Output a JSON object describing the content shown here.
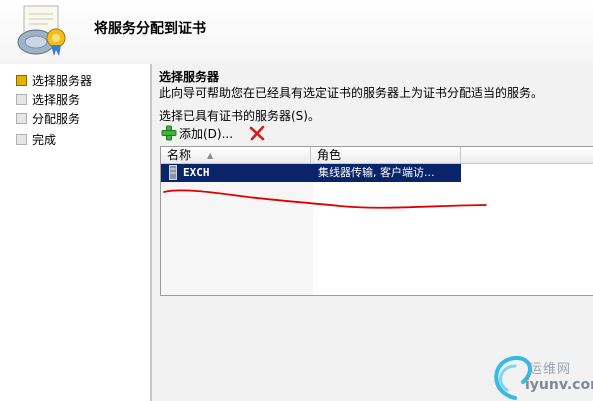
{
  "wizard": {
    "title": "将服务分配到证书",
    "icon": "certificate-server-icon"
  },
  "steps": [
    {
      "label": "选择服务器",
      "active": true
    },
    {
      "label": "选择服务",
      "active": false
    },
    {
      "label": "分配服务",
      "active": false
    },
    {
      "label": "完成",
      "active": false
    }
  ],
  "page": {
    "section_title": "选择服务器",
    "description": "此向导可帮助您在已经具有选定证书的服务器上为证书分配适当的服务。",
    "list_label": "选择已具有证书的服务器(S)。"
  },
  "toolbar": {
    "add_label": "添加(D)...",
    "add_icon": "green-plus-icon",
    "remove_icon": "red-x-icon"
  },
  "servers": {
    "columns": [
      "名称",
      "角色"
    ],
    "rows": [
      {
        "name": "EXCH",
        "role": "集线器传输, 客户端访..."
      }
    ]
  },
  "watermark": {
    "line1": "运维网",
    "line2": "iyunv.com"
  },
  "colors": {
    "selection": "#0a246a",
    "active_step": "#e1b200",
    "annotation": "#e00000"
  }
}
